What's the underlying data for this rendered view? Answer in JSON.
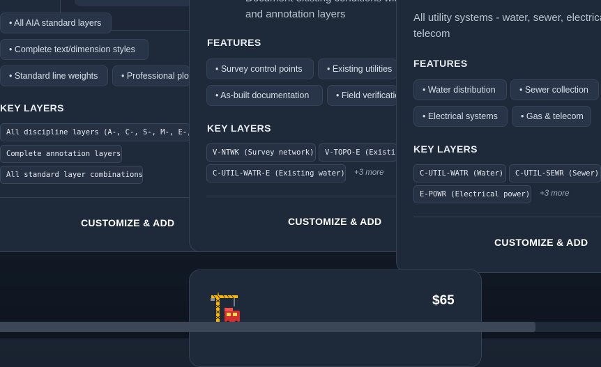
{
  "card_left": {
    "features": [
      "• All AIA standard layers",
      "• Complete text/dimension styles",
      "• Standard line weights",
      "• Professional plot styles"
    ],
    "key_layers_title": "KEY LAYERS",
    "key_layers": [
      "All discipline layers (A-, C-, S-, M-, E-, P-)",
      "Complete annotation layers",
      "All standard layer combinations"
    ],
    "cta": "CUSTOMIZE & ADD"
  },
  "card_middle": {
    "desc_line1": "Document existing conditions with survey",
    "desc_line2": "and annotation layers",
    "features_title": "FEATURES",
    "features": [
      "• Survey control points",
      "• Existing utilities",
      "• As-built documentation",
      "• Field verification"
    ],
    "key_layers_title": "KEY LAYERS",
    "key_layers": [
      "V-NTWK (Survey network)",
      "V-TOPO-E (Existing topography)",
      "C-UTIL-WATR-E (Existing water)"
    ],
    "more": "+3 more",
    "cta": "CUSTOMIZE & ADD"
  },
  "card_right": {
    "desc_line1": "All utility systems - water, sewer, electrical,",
    "desc_line2": "telecom",
    "features_title": "FEATURES",
    "features": [
      "• Water distribution",
      "• Sewer collection",
      "• Electrical systems",
      "• Gas & telecom"
    ],
    "key_layers_title": "KEY LAYERS",
    "key_layers": [
      "C-UTIL-WATR (Water)",
      "C-UTIL-SEWR (Sewer)",
      "E-POWR (Electrical power)"
    ],
    "more": "+3 more",
    "cta": "CUSTOMIZE & ADD"
  },
  "card_bottom": {
    "icon": "construction-crane-icon",
    "price": "$65"
  }
}
